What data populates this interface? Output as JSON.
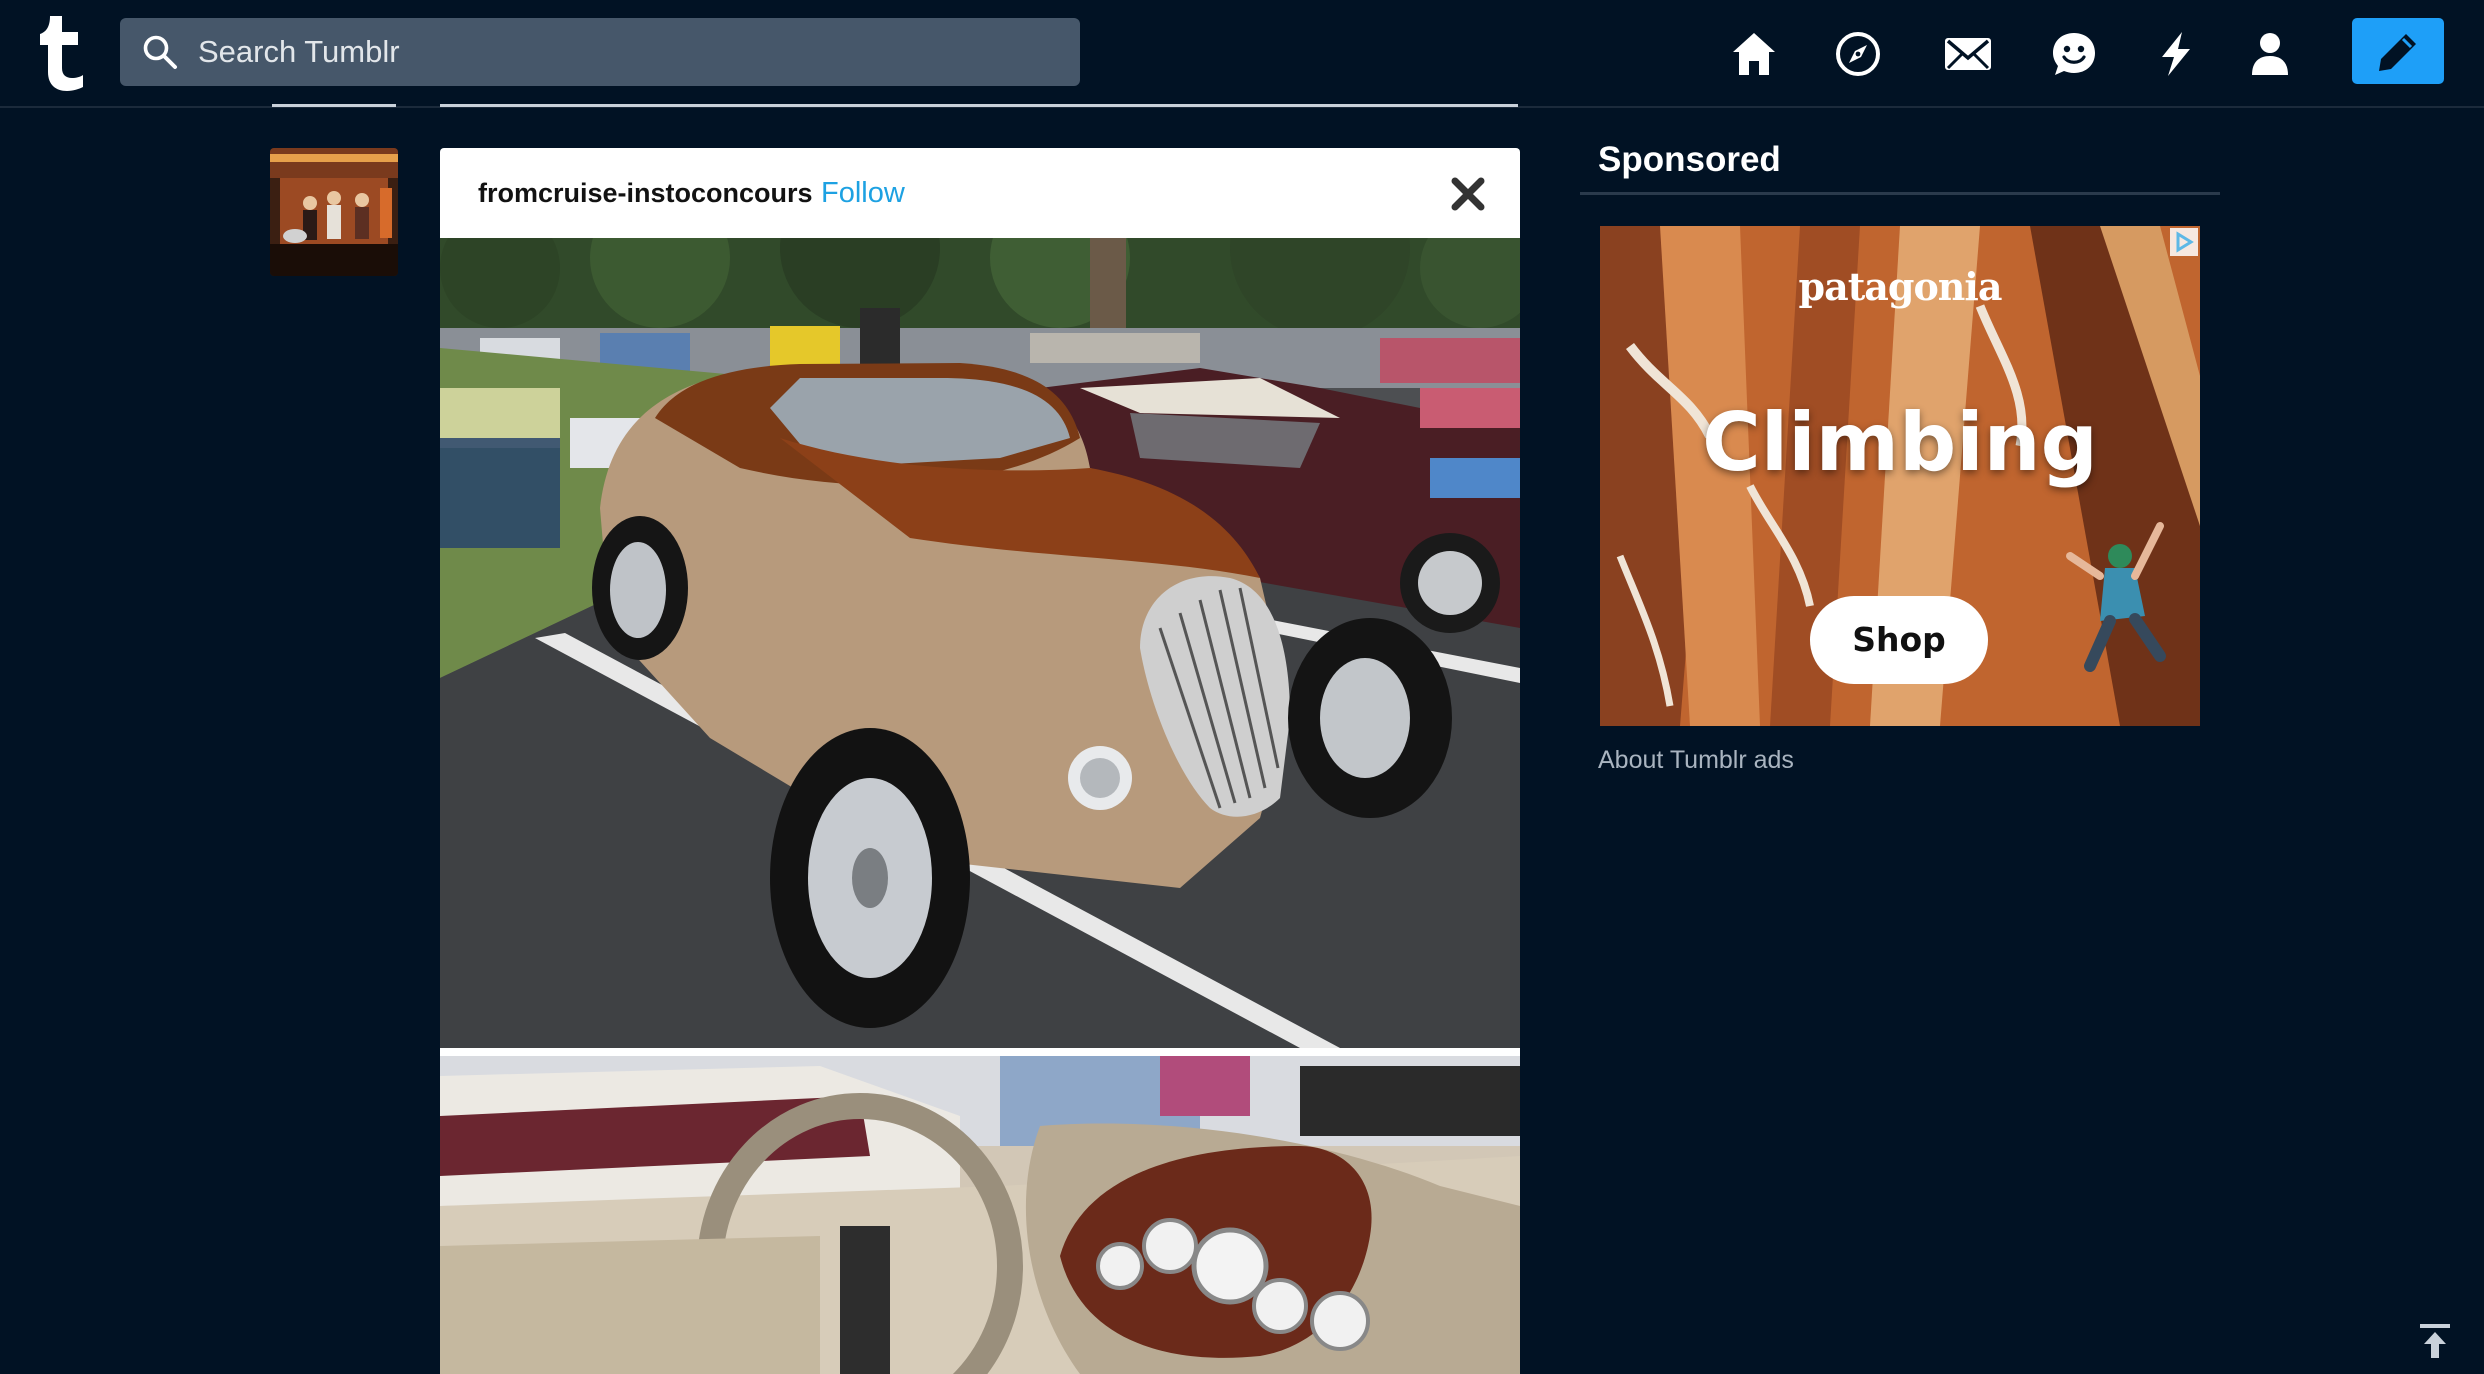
{
  "header": {
    "logo_alt": "tumblr",
    "search": {
      "placeholder": "Search Tumblr",
      "value": ""
    },
    "nav_icons": [
      "home-icon",
      "explore-icon",
      "inbox-icon",
      "messaging-icon",
      "activity-icon",
      "account-icon"
    ],
    "compose_icon": "pencil-icon",
    "compose_color": "#1e9ff8"
  },
  "post": {
    "blog_name": "fromcruise-instoconcours",
    "follow_label": "Follow",
    "close_icon": "close-icon",
    "follow_color": "#1da1e2",
    "photos": [
      "hot-rod-exterior-photo",
      "hot-rod-dashboard-photo"
    ]
  },
  "sidebar": {
    "sponsored_title": "Sponsored",
    "ad": {
      "brand": "patagonia",
      "headline": "Climbing",
      "cta": "Shop"
    },
    "about_ads": "About Tumblr ads"
  },
  "colors": {
    "background": "#011224",
    "search_bg": "#46576a"
  }
}
